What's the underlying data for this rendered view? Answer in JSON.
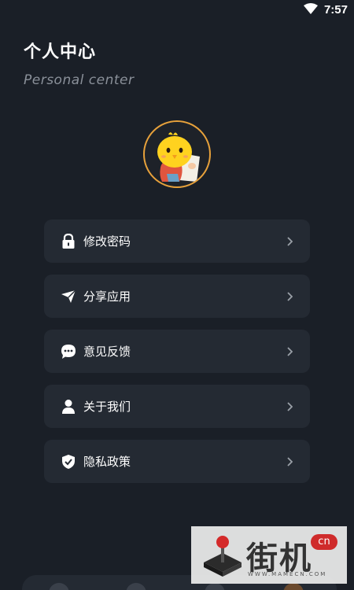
{
  "status_bar": {
    "time": "7:57",
    "wifi_icon": "wifi-icon"
  },
  "header": {
    "title": "个人中心",
    "subtitle": "Personal center"
  },
  "avatar": {
    "icon": "chick-avatar"
  },
  "menu": {
    "items": [
      {
        "label": "修改密码",
        "icon": "lock-icon"
      },
      {
        "label": "分享应用",
        "icon": "send-icon"
      },
      {
        "label": "意见反馈",
        "icon": "chat-bubble-icon"
      },
      {
        "label": "关于我们",
        "icon": "user-icon"
      },
      {
        "label": "隐私政策",
        "icon": "shield-check-icon"
      }
    ]
  },
  "watermark": {
    "text": "街机",
    "badge": "cn",
    "url": "WWW.MAMECN.COM"
  },
  "colors": {
    "background": "#1a1f27",
    "card": "#242a33",
    "accent": "#e7a13b",
    "subtitle": "#8a9099"
  }
}
